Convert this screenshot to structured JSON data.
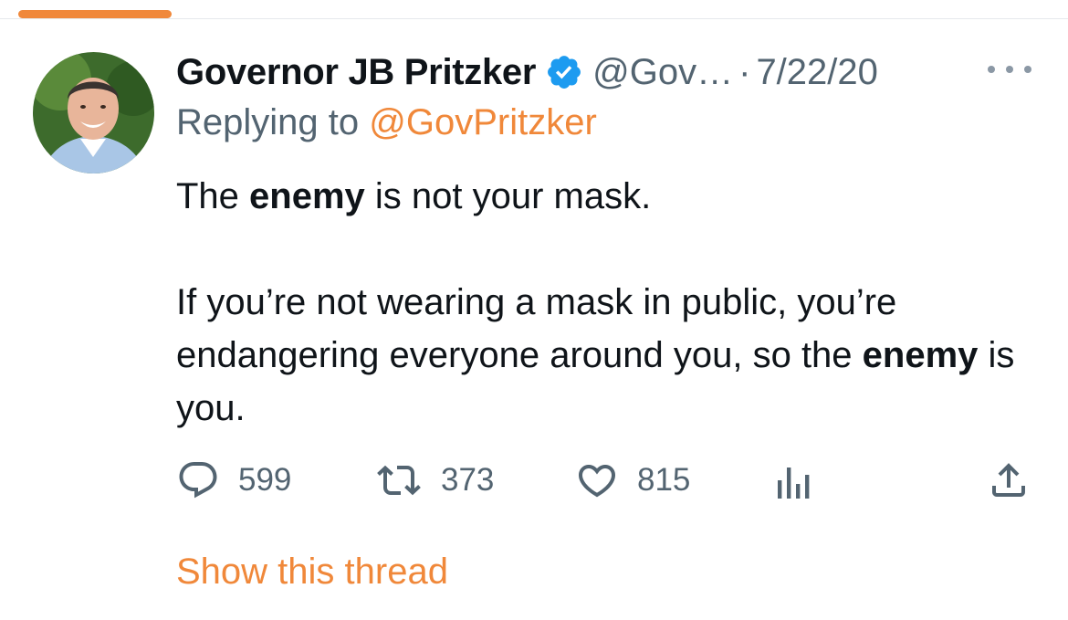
{
  "colors": {
    "accent": "#f0883a",
    "verified": "#1d9bf0",
    "secondary_text": "#536471"
  },
  "tweet": {
    "author_name": "Governor JB Pritzker",
    "verified_icon": "verified-badge-icon",
    "handle": "@Gov…",
    "separator": "·",
    "date": "7/22/20",
    "more_icon": "more-options-icon",
    "replying_prefix": "Replying to",
    "replying_to": "@GovPritzker",
    "body": {
      "p1_pre": "The ",
      "p1_bold": "enemy",
      "p1_post": " is not your mask.",
      "p2_pre": "If you’re not wearing a mask in public, you’re endangering everyone around you, so the ",
      "p2_bold": "enemy",
      "p2_post": " is you."
    },
    "actions": {
      "reply_count": "599",
      "retweet_count": "373",
      "like_count": "815",
      "reply_icon": "reply-icon",
      "retweet_icon": "retweet-icon",
      "like_icon": "heart-icon",
      "views_icon": "analytics-icon",
      "share_icon": "share-icon"
    },
    "show_thread": "Show this thread"
  }
}
